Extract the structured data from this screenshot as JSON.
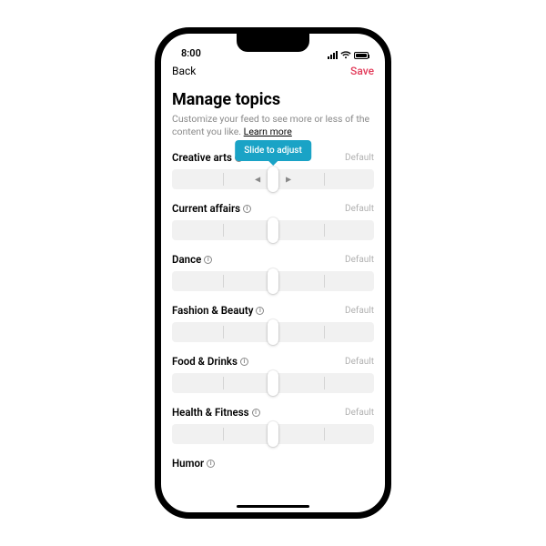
{
  "status": {
    "time": "8:00"
  },
  "nav": {
    "back": "Back",
    "save": "Save"
  },
  "page": {
    "title": "Manage topics",
    "desc": "Customize your feed to see more or less of the content you like. ",
    "learn_more": "Learn more"
  },
  "tooltip": "Slide to adjust",
  "default_label": "Default",
  "topics": [
    {
      "label": "Creative arts"
    },
    {
      "label": "Current affairs"
    },
    {
      "label": "Dance"
    },
    {
      "label": "Fashion & Beauty"
    },
    {
      "label": "Food & Drinks"
    },
    {
      "label": "Health & Fitness"
    },
    {
      "label": "Humor"
    }
  ]
}
